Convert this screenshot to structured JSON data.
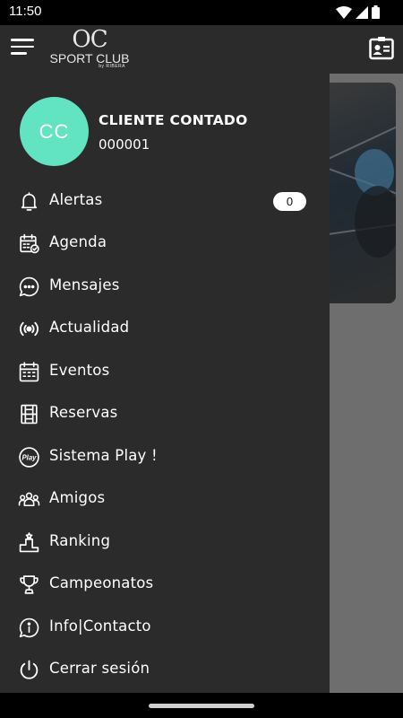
{
  "status_bar": {
    "time": "11:50",
    "icons": [
      "wifi-icon",
      "signal-icon",
      "battery-icon"
    ]
  },
  "app_bar": {
    "logo": {
      "line1": "OC",
      "line2": "SPORT CLUB",
      "line3": "by RIBERA"
    },
    "menu_icon": "hamburger-menu-icon",
    "contact_icon": "contact-card-icon"
  },
  "profile": {
    "initials": "CC",
    "name": "CLIENTE CONTADO",
    "id": "000001",
    "avatar_color": "#62e3c2"
  },
  "menu": {
    "items": [
      {
        "label": "Alertas",
        "icon": "bell-icon",
        "badge": "0"
      },
      {
        "label": "Agenda",
        "icon": "calendar-check-icon"
      },
      {
        "label": "Mensajes",
        "icon": "chat-bubble-icon"
      },
      {
        "label": "Actualidad",
        "icon": "broadcast-icon"
      },
      {
        "label": "Eventos",
        "icon": "calendar-grid-icon"
      },
      {
        "label": "Reservas",
        "icon": "court-icon"
      },
      {
        "label": "Sistema Play !",
        "icon": "play-logo-icon"
      },
      {
        "label": "Amigos",
        "icon": "people-icon"
      },
      {
        "label": "Ranking",
        "icon": "podium-icon"
      },
      {
        "label": "Campeonatos",
        "icon": "trophy-icon"
      },
      {
        "label": "Info|Contacto",
        "icon": "info-bubble-icon"
      },
      {
        "label": "Cerrar sesión",
        "icon": "power-icon"
      }
    ]
  },
  "colors": {
    "drawer_bg": "#2b2b2b",
    "overlay_bg": "#6e6e6e",
    "accent": "#62e3c2"
  }
}
